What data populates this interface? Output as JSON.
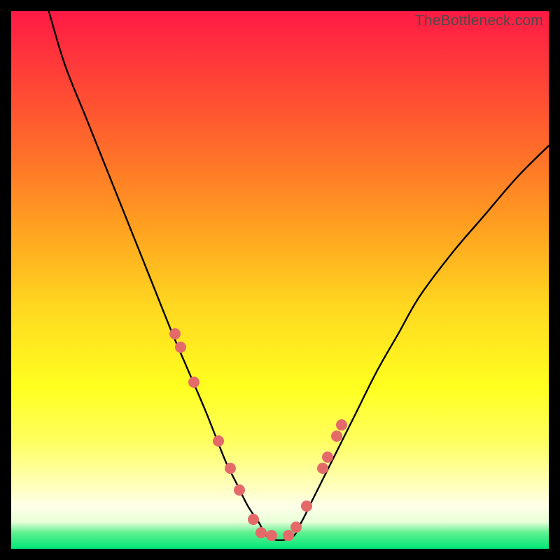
{
  "watermark": "TheBottleneck.com",
  "colors": {
    "markerFill": "#e46a6a",
    "curveStroke": "#000000"
  },
  "chart_data": {
    "type": "line",
    "title": "",
    "xlabel": "",
    "ylabel": "",
    "xlim": [
      0,
      100
    ],
    "ylim": [
      0,
      100
    ],
    "grid": false,
    "series": [
      {
        "name": "curve",
        "x": [
          7,
          10,
          14,
          18,
          22,
          26,
          30,
          33,
          36,
          38,
          40,
          42,
          44,
          46,
          48,
          52,
          54,
          56,
          60,
          64,
          68,
          72,
          76,
          82,
          88,
          94,
          100
        ],
        "y": [
          100,
          90,
          80,
          70,
          60,
          50,
          40,
          33,
          26,
          21,
          16,
          12,
          8,
          5,
          2,
          2,
          5,
          9,
          17,
          25,
          33,
          40,
          47,
          55,
          62,
          69,
          75
        ]
      }
    ],
    "markers": {
      "name": "data-points",
      "x": [
        30.5,
        31.5,
        34.0,
        38.5,
        40.8,
        42.5,
        45.0,
        46.5,
        48.5,
        51.5,
        53.0,
        55.0,
        58.0,
        58.8,
        60.5,
        61.5
      ],
      "y": [
        40.0,
        37.5,
        31.0,
        20.0,
        15.0,
        11.0,
        5.5,
        3.0,
        2.5,
        2.5,
        4.0,
        8.0,
        15.0,
        17.0,
        21.0,
        23.0
      ]
    }
  }
}
